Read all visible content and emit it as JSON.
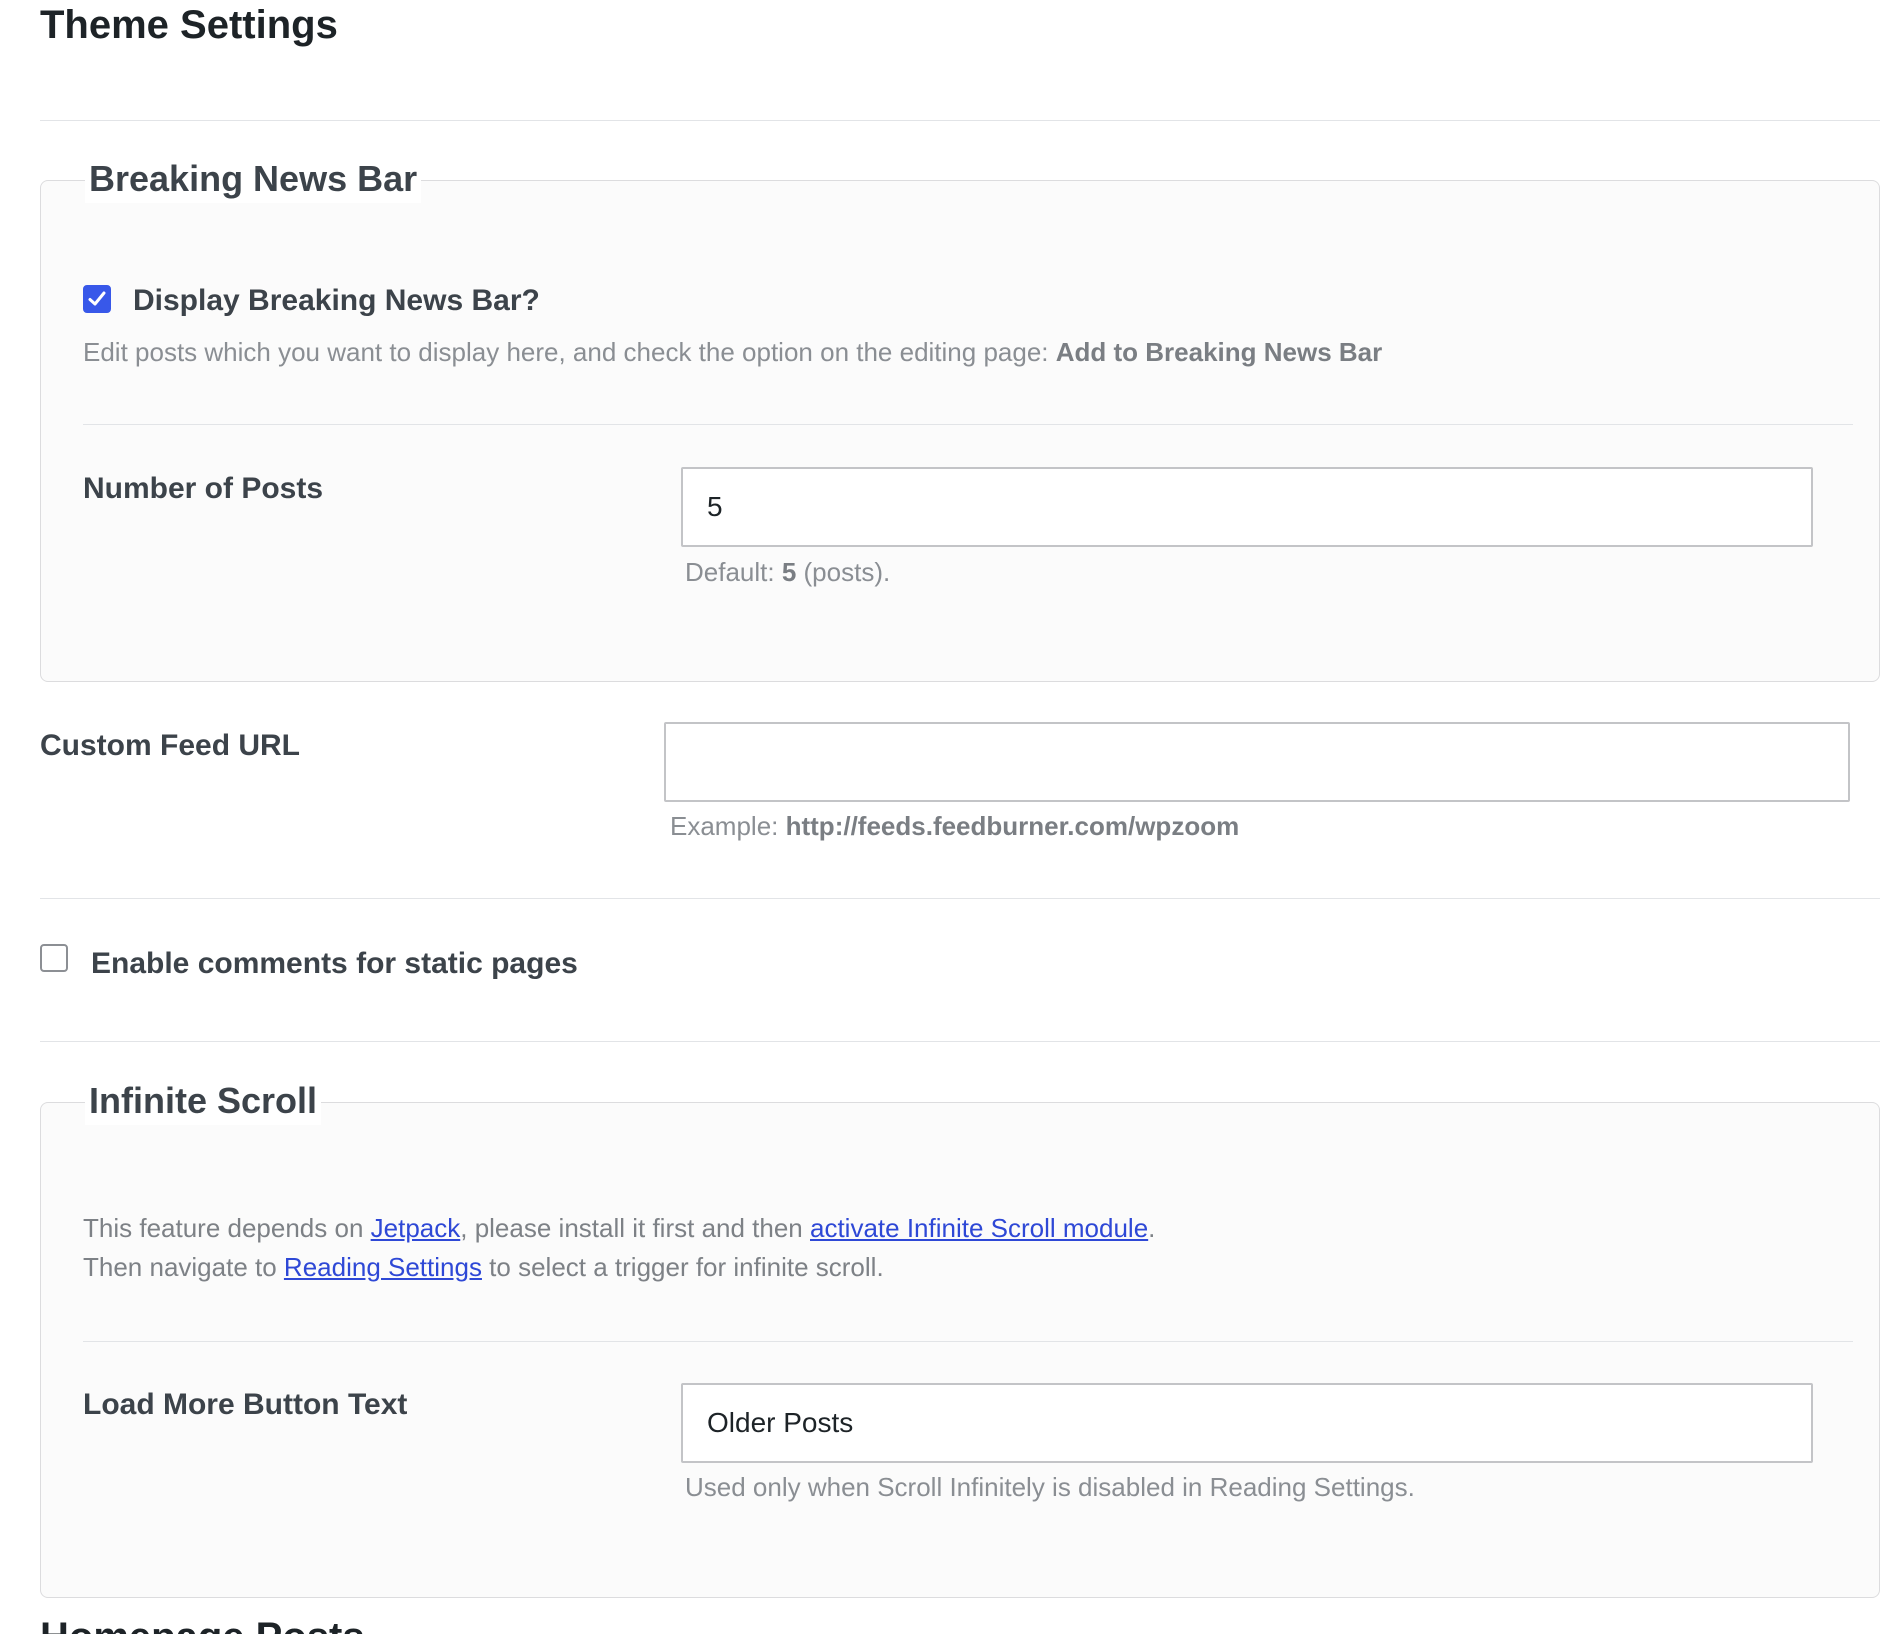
{
  "page": {
    "title": "Theme Settings"
  },
  "breaking_news": {
    "legend": "Breaking News Bar",
    "display_checkbox_label": "Display Breaking News Bar?",
    "display_checked": true,
    "display_desc_text": "Edit posts which you want to display here, and check the option on the editing page: ",
    "display_desc_strong": "Add to Breaking News Bar",
    "num_posts_label": "Number of Posts",
    "num_posts_value": "5",
    "num_posts_desc_prefix": "Default: ",
    "num_posts_desc_strong": "5",
    "num_posts_desc_suffix": " (posts)."
  },
  "custom_feed": {
    "label": "Custom Feed URL",
    "value": "",
    "desc_prefix": "Example: ",
    "desc_strong": "http://feeds.feedburner.com/wpzoom"
  },
  "comments": {
    "label": "Enable comments for static pages",
    "checked": false
  },
  "infinite_scroll": {
    "legend": "Infinite Scroll",
    "line1_a": "This feature depends on ",
    "line1_link1": "Jetpack",
    "line1_b": ", please install it first and then ",
    "line1_link2": "activate Infinite Scroll module",
    "line1_c": ".",
    "line2_a": "Then navigate to ",
    "line2_link": "Reading Settings",
    "line2_b": " to select a trigger for infinite scroll.",
    "load_more_label": "Load More Button Text",
    "load_more_value": "Older Posts",
    "load_more_desc": "Used only when Scroll Infinitely is disabled in Reading Settings."
  },
  "next_section": {
    "title_partial": "Homepage Posts"
  },
  "colors": {
    "accent": "#3858e9",
    "link": "#2e48d6"
  }
}
